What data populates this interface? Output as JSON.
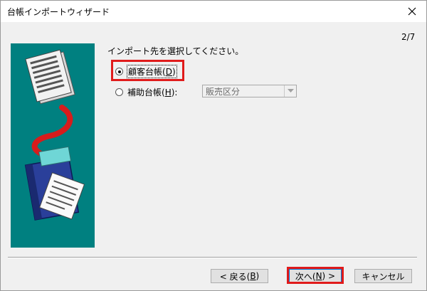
{
  "window": {
    "title": "台帳インポートウィザード"
  },
  "page_indicator": "2/7",
  "instruction": "インポート先を選択してください。",
  "options": [
    {
      "label": "顧客台帳",
      "hotkey_open": "(",
      "hotkey": "D",
      "hotkey_close": ")",
      "checked": true
    },
    {
      "label": "補助台帳",
      "hotkey_open": "(",
      "hotkey": "H",
      "hotkey_close": "):",
      "checked": false
    }
  ],
  "subledger_select": {
    "value": "販売区分",
    "disabled": true
  },
  "buttons": {
    "back": {
      "label": "< 戻る(",
      "hotkey": "B",
      "close": ")"
    },
    "next": {
      "label": "次へ(",
      "hotkey": "N",
      "close": ") >"
    },
    "cancel": {
      "label": "キャンセル"
    }
  },
  "colors": {
    "illustration_bg": "#008080",
    "highlight": "#e01b1b"
  }
}
